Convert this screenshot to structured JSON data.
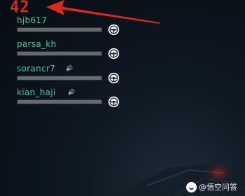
{
  "hud": {
    "counter": "42"
  },
  "players": [
    {
      "name": "hjb617",
      "talking": false,
      "health": 1.0
    },
    {
      "name": "parsa_kh",
      "talking": false,
      "health": 1.0
    },
    {
      "name": "sorancr7",
      "talking": true,
      "health": 1.0
    },
    {
      "name": "kian_haji",
      "talking": true,
      "health": 1.0
    }
  ],
  "icons": {
    "role": "steering-wheel-icon",
    "voice": "speaker-icon"
  },
  "colors": {
    "counter": "#e0271f",
    "arrow": "#e0271f",
    "player_name": "#3ec4b5",
    "bar": "#646a6d"
  },
  "watermark": {
    "text": "@悟空问答"
  }
}
